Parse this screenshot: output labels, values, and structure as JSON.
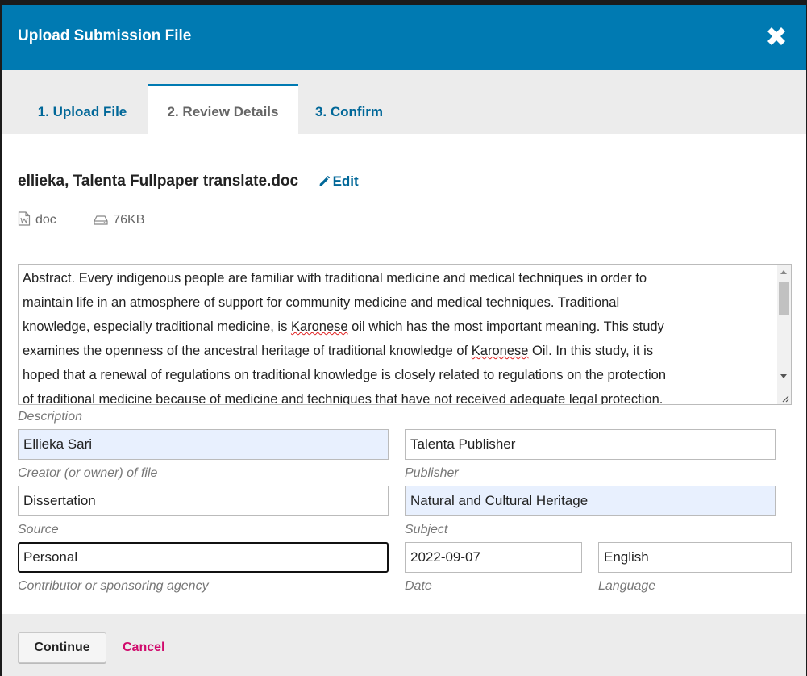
{
  "modal": {
    "title": "Upload Submission File"
  },
  "tabs": [
    {
      "label": "1. Upload File"
    },
    {
      "label": "2. Review Details"
    },
    {
      "label": "3. Confirm"
    }
  ],
  "active_tab": 1,
  "file": {
    "name": "ellieka, Talenta Fullpaper translate.doc",
    "edit_label": "Edit",
    "type": "doc",
    "size": "76KB"
  },
  "abstract": {
    "lines": [
      [
        "Abstract. Every indigenous people are familiar with traditional medicine and medical techniques in order to"
      ],
      [
        "maintain life in an atmosphere of support for community medicine and medical techniques. Traditional"
      ],
      [
        "knowledge, especially traditional medicine, is ",
        {
          "sp": "Karonese"
        },
        " oil which has the most important meaning. This study"
      ],
      [
        "examines the openness of the ancestral heritage of traditional knowledge of ",
        {
          "sp": "Karonese"
        },
        " Oil. In this study, it is"
      ],
      [
        "hoped that a renewal of regulations on traditional knowledge is closely related to regulations on the protection"
      ],
      [
        "of traditional medicine because of medicine and techniques that have not received adequate legal protection."
      ]
    ]
  },
  "fields": {
    "description_label": "Description",
    "creator": {
      "value": "Ellieka Sari",
      "label": "Creator (or owner) of file"
    },
    "publisher": {
      "value": "Talenta Publisher",
      "label": "Publisher"
    },
    "source": {
      "value": "Dissertation",
      "label": "Source"
    },
    "subject": {
      "value": "Natural and Cultural Heritage",
      "label": "Subject"
    },
    "contributor": {
      "value": "Personal",
      "label": "Contributor or sponsoring agency"
    },
    "date": {
      "value": "2022-09-07",
      "label": "Date"
    },
    "language": {
      "value": "English",
      "label": "Language"
    }
  },
  "footer": {
    "continue_label": "Continue",
    "cancel_label": "Cancel"
  },
  "colors": {
    "header": "#007ab2",
    "link": "#006798",
    "cancel": "#d00a6c",
    "autofill": "#e8f0fe"
  },
  "icons": {
    "close": "close-icon",
    "edit": "pencil-icon",
    "file_type": "word-file-icon",
    "size": "hard-drive-icon"
  }
}
